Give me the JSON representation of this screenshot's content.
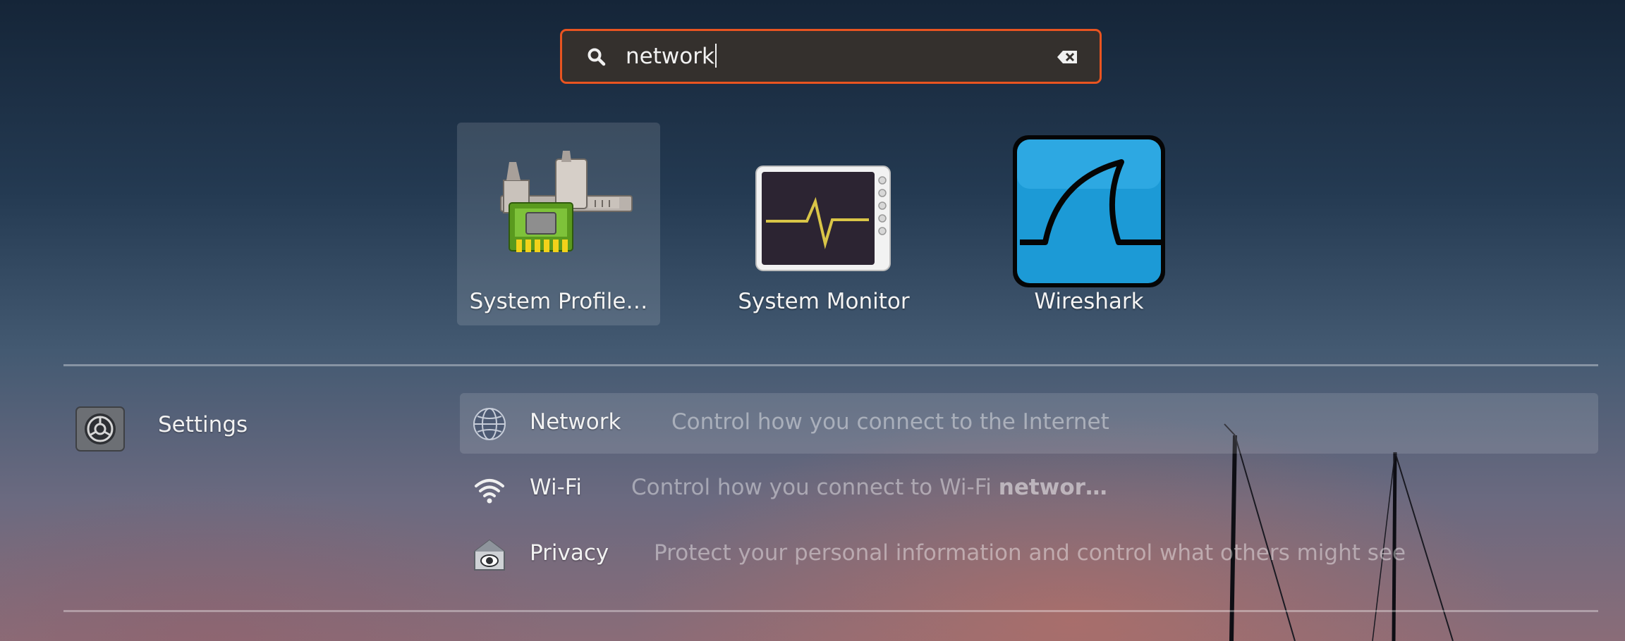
{
  "search": {
    "value": "network",
    "icon": "search-icon",
    "clear_icon": "clear-text-icon",
    "accent_color": "#e95420"
  },
  "apps": [
    {
      "label": "System Profile…",
      "icon": "system-profiler-icon",
      "selected": true
    },
    {
      "label": "System Monitor",
      "icon": "system-monitor-icon",
      "selected": false
    },
    {
      "label": "Wireshark",
      "icon": "wireshark-icon",
      "selected": false
    }
  ],
  "settings_section": {
    "provider_label": "Settings",
    "provider_icon": "settings-icon",
    "results": [
      {
        "name": "Network",
        "description": "Control how you connect to the Internet",
        "description_bold": "",
        "icon": "network-globe-icon",
        "selected": true
      },
      {
        "name": "Wi-Fi",
        "description": "Control how you connect to Wi-Fi ",
        "description_bold": "networ…",
        "icon": "wifi-icon",
        "selected": false
      },
      {
        "name": "Privacy",
        "description": "Protect your personal information and control what others might see",
        "description_bold": "",
        "icon": "privacy-icon",
        "selected": false
      }
    ]
  }
}
